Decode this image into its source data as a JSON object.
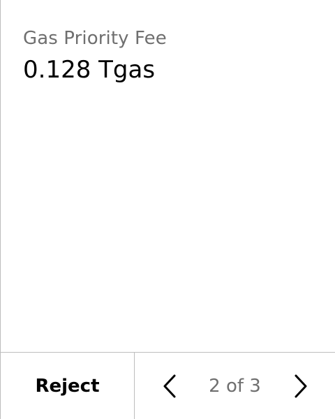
{
  "field": {
    "label": "Gas Priority Fee",
    "value": "0.128 Tgas"
  },
  "footer": {
    "reject_label": "Reject",
    "page_indicator": "2 of 3",
    "prev_icon": "chevron-left-icon",
    "next_icon": "chevron-right-icon"
  },
  "colors": {
    "background": "#ffffff",
    "label": "#6f6f6f",
    "value": "#000000",
    "divider": "#bdbdbd"
  }
}
